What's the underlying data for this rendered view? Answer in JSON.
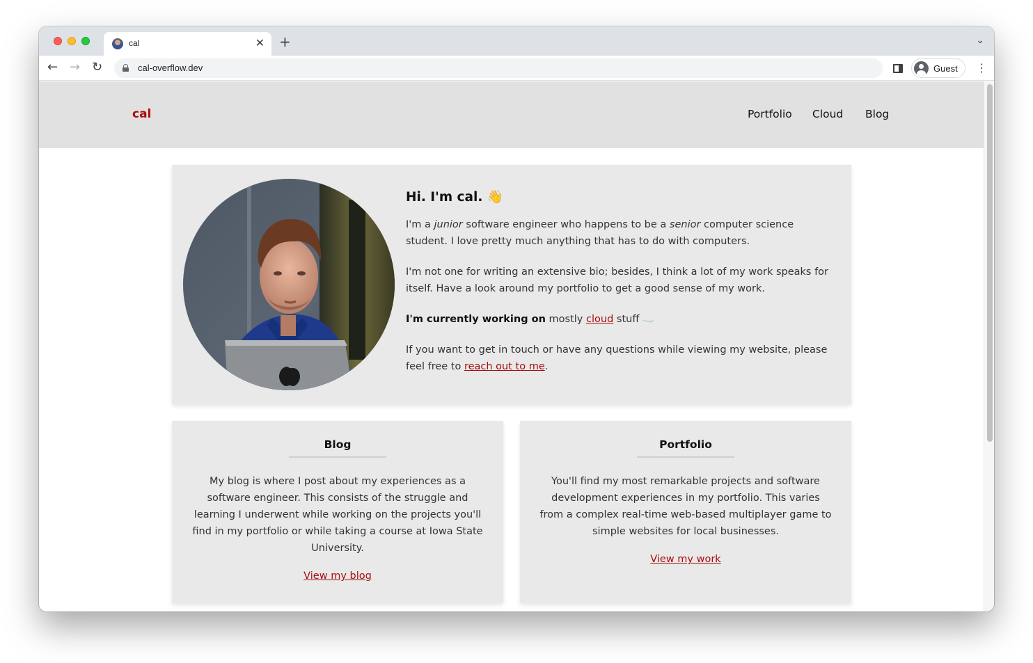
{
  "browser": {
    "tab_title": "cal",
    "tab_close_glyph": "✕",
    "new_tab_glyph": "+",
    "tab_search_glyph": "⌄",
    "back_glyph": "←",
    "forward_glyph": "→",
    "reload_glyph": "↻",
    "url": "cal-overflow.dev",
    "profile_label": "Guest",
    "menu_glyph": "⋮"
  },
  "site": {
    "logo": "cal",
    "nav": [
      "Portfolio",
      "Cloud",
      "Blog"
    ]
  },
  "hero": {
    "heading": "Hi. I'm cal. 👋",
    "p1_a": "I'm a ",
    "p1_em1": "junior",
    "p1_b": " software engineer who happens to be a ",
    "p1_em2": "senior",
    "p1_c": " computer science student. I love pretty much anything that has to do with computers.",
    "p2": "I'm not one for writing an extensive bio; besides, I think a lot of my work speaks for itself. Have a look around my portfolio to get a good sense of my work.",
    "p3_strong": "I'm currently working on",
    "p3_a": " mostly ",
    "p3_link": "cloud",
    "p3_b": " stuff ☁️",
    "p4_a": "If you want to get in touch or have any questions while viewing my website, please feel free to ",
    "p4_link": "reach out to me",
    "p4_b": "."
  },
  "cards": {
    "blog": {
      "title": "Blog",
      "body": "My blog is where I post about my experiences as a software engineer. This consists of the struggle and learning I underwent while working on the projects you'll find in my portfolio or while taking a course at Iowa State University.",
      "link": "View my blog"
    },
    "portfolio": {
      "title": "Portfolio",
      "body": "You'll find my most remarkable projects and software development experiences in my portfolio. This varies from a complex real-time web-based multiplayer game to simple websites for local businesses.",
      "link": "View my work"
    }
  },
  "colors": {
    "accent": "#a60d0d",
    "header_bg": "#e1e1e1",
    "card_bg": "#e9e9e9"
  }
}
